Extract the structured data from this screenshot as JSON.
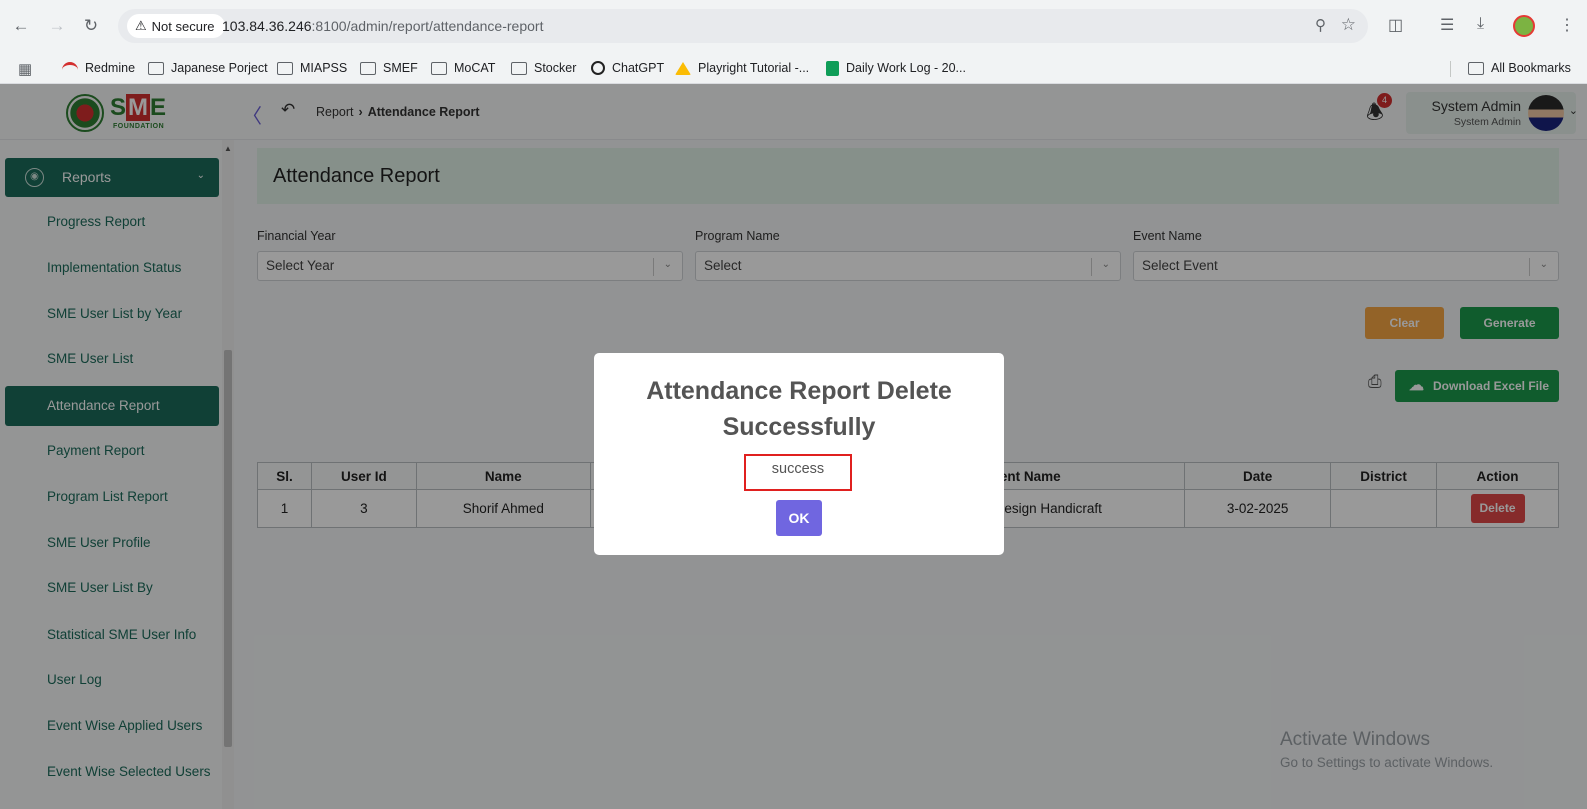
{
  "browser": {
    "security_label": "Not secure",
    "url_host": "103.84.36.246",
    "url_rest": ":8100/admin/report/attendance-report",
    "bookmarks": [
      "Redmine",
      "Japanese Porject",
      "MIAPSS",
      "SMEF",
      "MoCAT",
      "Stocker",
      "ChatGPT",
      "Playright Tutorial -...",
      "Daily Work Log - 20..."
    ],
    "all_bookmarks": "All Bookmarks"
  },
  "header": {
    "logo_text": "FOUNDATION",
    "breadcrumb_parent": "Report",
    "breadcrumb_current": "Attendance Report",
    "notification_count": "4",
    "user_name": "System Admin",
    "user_role": "System Admin"
  },
  "sidebar": {
    "group_label": "Reports",
    "items": [
      "Progress Report",
      "Implementation Status",
      "SME User List by Year",
      "SME User List",
      "Attendance Report",
      "Payment Report",
      "Program List Report",
      "SME User Profile",
      "SME User List By",
      "Statistical SME User Info",
      "User Log",
      "Event Wise Applied Users",
      "Event Wise Selected Users"
    ]
  },
  "page": {
    "title": "Attendance Report",
    "filters": {
      "financial_year_label": "Financial Year",
      "financial_year_value": "Select Year",
      "program_label": "Program Name",
      "program_value": "Select",
      "event_label": "Event Name",
      "event_value": "Select Event"
    },
    "clear_label": "Clear",
    "generate_label": "Generate",
    "download_label": "Download Excel File"
  },
  "table": {
    "headers": [
      "Sl.",
      "User Id",
      "Name",
      "",
      "Event Name",
      "Date",
      "District",
      "Action"
    ],
    "rows": [
      {
        "sl": "1",
        "user_id": "3",
        "name": "Shorif Ahmed",
        "hidden": "",
        "event": "n Design Handicraft",
        "date": "3-02-2025",
        "district": "",
        "action": "Delete"
      }
    ]
  },
  "modal": {
    "title": "Attendance Report Delete Successfully",
    "message": "success",
    "ok_label": "OK"
  },
  "watermark": {
    "line1": "Activate Windows",
    "line2": "Go to Settings to activate Windows."
  }
}
